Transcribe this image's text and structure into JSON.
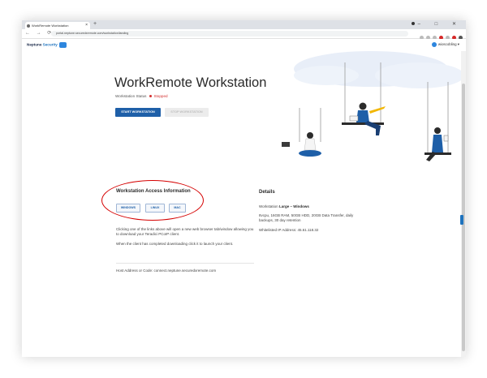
{
  "browser": {
    "tab_title": "WorkRemote Workstation",
    "tab_close": "×",
    "new_tab": "+",
    "url": "portal.neptune.securedxremote.com/workstation/landing",
    "nav_controls": "← → ⟳",
    "window_controls": "‒ □ ✕"
  },
  "header": {
    "logo_prefix": "Neptune",
    "logo_suffix": "Security",
    "user_name": "wioscobling",
    "user_chevron": "▾"
  },
  "hero": {
    "title": "WorkRemote Workstation",
    "status_label": "Workstation Status",
    "status_value": "Stopped",
    "start_button": "START WORKSTATION",
    "stop_button": "STOP WORKSTATION"
  },
  "access": {
    "title": "Workstation Access Information",
    "buttons": [
      "WINDOWS",
      "LINUX",
      "MAC"
    ],
    "paragraph1": "Clicking one of the links above will open a new web browser tab/window allowing you to download your Teradici PCoIP client.",
    "paragraph2": "When the client has completed downloading click it to launch your client.",
    "host_address": "Host Address or Code: connect.neptune.securedxremote.com"
  },
  "details": {
    "title": "Details",
    "workstation_label": "Workstation",
    "workstation_value": "Large – Windows",
    "specs": "8vcpu, 16GB RAM, 50GB HDD, 20GB Data Transfer, daily backups, 30 day retention",
    "whitelist": "Whitelisted IP Address: 45.61.118.32"
  },
  "colors": {
    "accent": "#1e5fa8",
    "status_stopped": "#d32f2f",
    "annotation": "#d50000"
  }
}
